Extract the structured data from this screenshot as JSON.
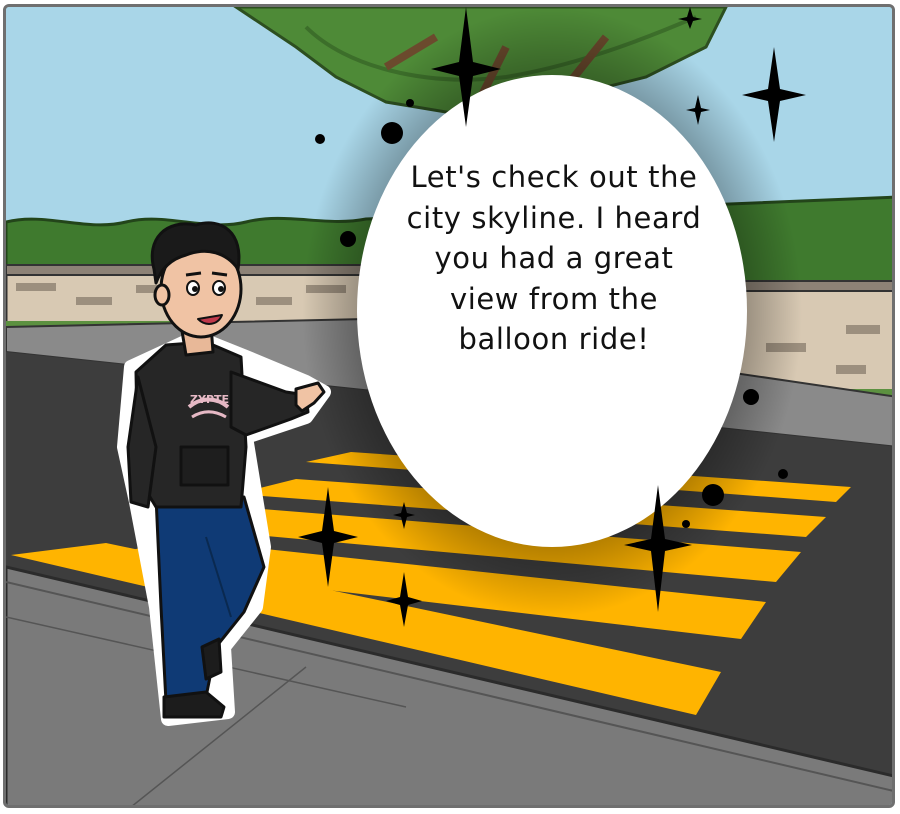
{
  "panel": {
    "speech_bubble": {
      "text": "Let's check out the city skyline. I heard you had a great view from the balloon ride!"
    },
    "colors": {
      "sky": "#a9d6e8",
      "road": "#3d3d3d",
      "crosswalk_stripe": "#ffb400",
      "sidewalk": "#7a7a7a",
      "wall": "#d8c9b3",
      "hedge": "#3f7a2e",
      "hoodie": "#262626",
      "jeans": "#0f3a75",
      "bubble_fill": "#ffffff",
      "bubble_glow": "#2b2b2b"
    }
  }
}
